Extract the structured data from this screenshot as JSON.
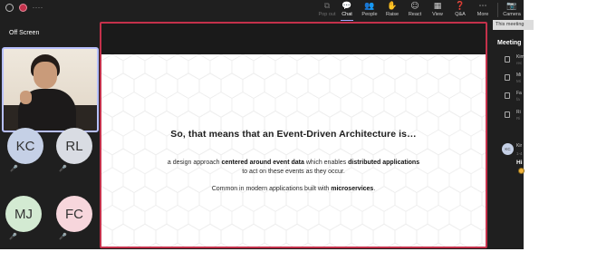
{
  "topbar": {
    "rec_dashes": "----",
    "items": [
      {
        "label": "Pop out",
        "icon": "pop-out-icon",
        "glyph": "⧉"
      },
      {
        "label": "Chat",
        "icon": "chat-icon",
        "glyph": "💬"
      },
      {
        "label": "People",
        "icon": "people-icon",
        "glyph": "👥"
      },
      {
        "label": "Raise",
        "icon": "raise-hand-icon",
        "glyph": "✋"
      },
      {
        "label": "React",
        "icon": "react-icon",
        "glyph": "☺"
      },
      {
        "label": "View",
        "icon": "view-icon",
        "glyph": "▦"
      },
      {
        "label": "Q&A",
        "icon": "qna-icon",
        "glyph": "❓"
      },
      {
        "label": "More",
        "icon": "more-icon",
        "glyph": "⋯"
      },
      {
        "label": "Camera",
        "icon": "camera-icon",
        "glyph": "📷"
      }
    ]
  },
  "left_panel": {
    "heading": "Off Screen",
    "participants": [
      {
        "initials": "KC",
        "color": "#c5d0e6"
      },
      {
        "initials": "RL",
        "color": "#d9dce3"
      },
      {
        "initials": "MJ",
        "color": "#d3ead2"
      },
      {
        "initials": "FC",
        "color": "#f7d6dc"
      }
    ]
  },
  "slide": {
    "title": "So, that means that an Event-Driven Architecture is…",
    "p1_a": "a design approach ",
    "p1_b": "centered around event data",
    "p1_c": " which enables ",
    "p1_d": "distributed applications",
    "p1_line2": "to act on these events as they occur.",
    "p2_a": "Common in modern applications built with ",
    "p2_b": "microservices",
    "p2_c": "."
  },
  "right_panel": {
    "tooltip": "This meeting",
    "heading": "Meeting",
    "chats": [
      {
        "name": "Kim",
        "sub": "rec"
      },
      {
        "name": "Mi",
        "sub": "Mi"
      },
      {
        "name": "Fa",
        "sub": "fa"
      },
      {
        "name": "Ri",
        "sub": "Ri"
      }
    ],
    "message": {
      "initials": "KC",
      "name": "Kir",
      "sub": "1-4",
      "text": "Hi"
    }
  },
  "colors": {
    "accent_red": "#c4314b",
    "tile_border": "#b8c0ff",
    "bg": "#1f1f1f"
  }
}
